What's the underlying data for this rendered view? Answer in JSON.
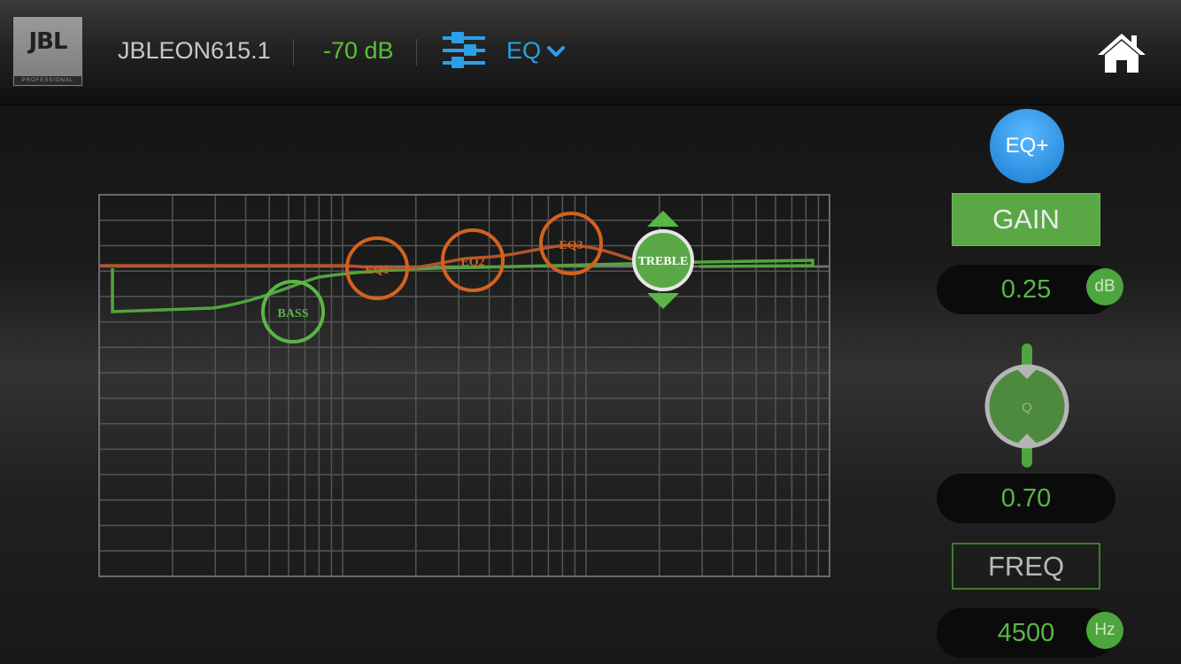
{
  "header": {
    "logo": {
      "mark": "JBL",
      "sub": "PROFESSIONAL"
    },
    "device_name": "JBLEON615.1",
    "level": "-70 dB",
    "eq_menu": "EQ",
    "icons": {
      "sliders": "sliders-icon",
      "chevron": "chevron-down-icon",
      "home": "home-icon"
    }
  },
  "graph": {
    "nodes": [
      {
        "label": "BASS",
        "color": "#5ab547",
        "selected": false
      },
      {
        "label": "EQ1",
        "color": "#d4621f",
        "selected": false
      },
      {
        "label": "EQ2",
        "color": "#d4621f",
        "selected": false
      },
      {
        "label": "EQ3",
        "color": "#d4621f",
        "selected": false
      },
      {
        "label": "TREBLE",
        "color": "#5ab547",
        "selected": true
      }
    ]
  },
  "controls": {
    "eq_plus": "EQ+",
    "gain_label": "GAIN",
    "gain_value": "0.25",
    "gain_unit": "dB",
    "q_label": "Q",
    "q_value": "0.70",
    "freq_label": "FREQ",
    "freq_value": "4500",
    "freq_unit": "Hz"
  },
  "colors": {
    "accent_green": "#5ab547",
    "accent_blue": "#2c9fe6",
    "band_orange": "#d4621f"
  }
}
